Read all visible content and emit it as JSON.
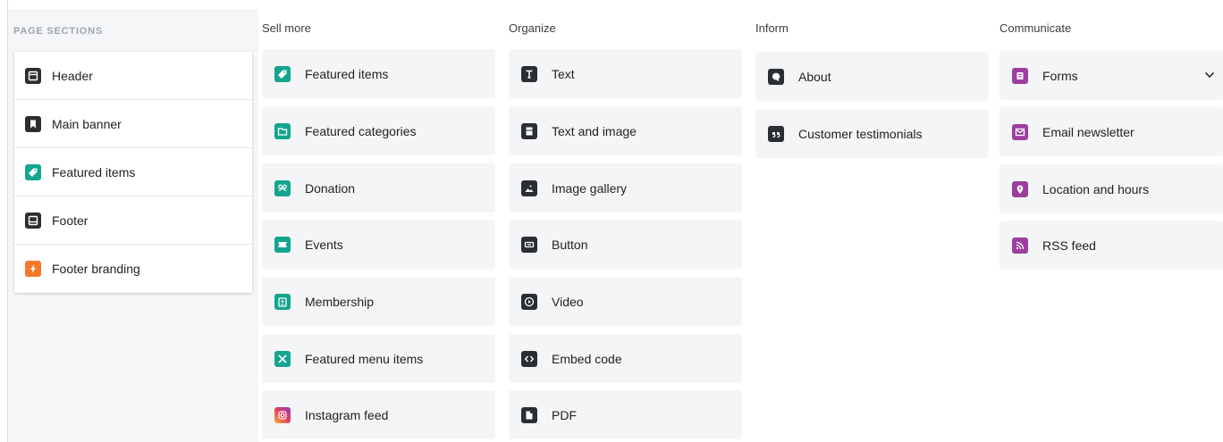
{
  "page_sections": {
    "heading": "PAGE SECTIONS",
    "items": [
      {
        "label": "Header",
        "icon": "header-icon"
      },
      {
        "label": "Main banner",
        "icon": "bookmark-icon"
      },
      {
        "label": "Featured items",
        "icon": "tag-icon"
      },
      {
        "label": "Footer",
        "icon": "footer-icon"
      },
      {
        "label": "Footer branding",
        "icon": "lightning-icon"
      }
    ]
  },
  "columns": [
    {
      "title": "Sell more",
      "items": [
        {
          "label": "Featured items",
          "icon": "tag-icon"
        },
        {
          "label": "Featured categories",
          "icon": "folder-icon"
        },
        {
          "label": "Donation",
          "icon": "donation-icon"
        },
        {
          "label": "Events",
          "icon": "ticket-icon"
        },
        {
          "label": "Membership",
          "icon": "badge-icon"
        },
        {
          "label": "Featured menu items",
          "icon": "utensils-icon"
        },
        {
          "label": "Instagram feed",
          "icon": "instagram-icon"
        }
      ]
    },
    {
      "title": "Organize",
      "items": [
        {
          "label": "Text",
          "icon": "text-icon"
        },
        {
          "label": "Text and image",
          "icon": "text-image-icon"
        },
        {
          "label": "Image gallery",
          "icon": "image-icon"
        },
        {
          "label": "Button",
          "icon": "button-icon"
        },
        {
          "label": "Video",
          "icon": "play-icon"
        },
        {
          "label": "Embed code",
          "icon": "code-icon"
        },
        {
          "label": "PDF",
          "icon": "file-icon"
        }
      ]
    },
    {
      "title": "Inform",
      "items": [
        {
          "label": "About",
          "icon": "chat-icon"
        },
        {
          "label": "Customer testimonials",
          "icon": "quote-icon"
        }
      ]
    },
    {
      "title": "Communicate",
      "items": [
        {
          "label": "Forms",
          "icon": "form-icon"
        },
        {
          "label": "Email newsletter",
          "icon": "mail-icon"
        },
        {
          "label": "Location and hours",
          "icon": "location-icon"
        },
        {
          "label": "RSS feed",
          "icon": "rss-icon"
        }
      ]
    }
  ],
  "colors": {
    "dark_icon": "#2b2f33",
    "teal_icon": "#13a58f",
    "orange_icon": "#f7772a",
    "purple_icon": "#9c3f9f",
    "tile_bg": "#f4f5f6"
  }
}
